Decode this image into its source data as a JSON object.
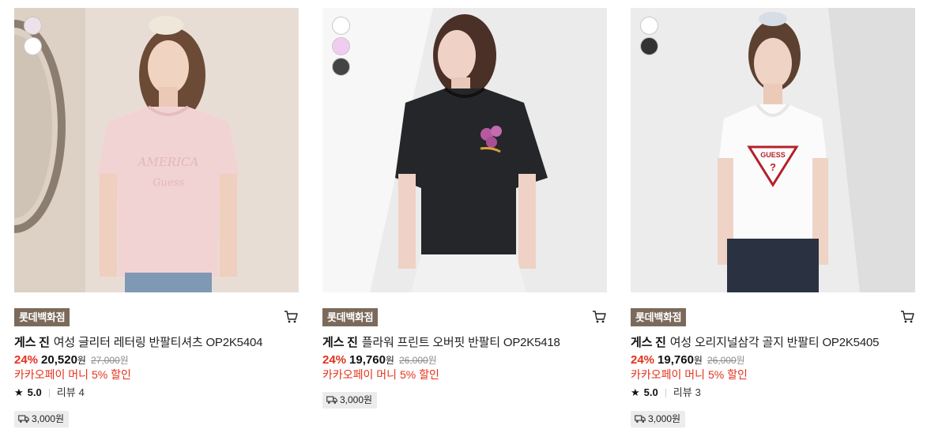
{
  "products": [
    {
      "swatches": [
        "#efe1ea",
        "#ffffff"
      ],
      "store": "롯데백화점",
      "brand": "게스 진",
      "name": "여성 글리터 레터링 반팔티셔츠 OP2K5404",
      "discount": "24%",
      "price": "20,520",
      "price_unit": "원",
      "original_price": "27,000",
      "original_unit": "원",
      "promo": "카카오페이 머니 5% 할인",
      "rating": "5.0",
      "review_label": "리뷰",
      "review_count": "4",
      "shipping": "3,000원",
      "colors": {
        "bg": "#e6dbd3",
        "shirt": "#f2d3d4"
      }
    },
    {
      "swatches": [
        "#ffffff",
        "#f0cdf0",
        "#444444"
      ],
      "store": "롯데백화점",
      "brand": "게스 진",
      "name": "플라워 프린트 오버핏 반팔티 OP2K5418",
      "discount": "24%",
      "price": "19,760",
      "price_unit": "원",
      "original_price": "26,000",
      "original_unit": "원",
      "promo": "카카오페이 머니 5% 할인",
      "shipping": "3,000원",
      "colors": {
        "bg": "#ebebec",
        "shirt": "#24262a"
      }
    },
    {
      "swatches": [
        "#ffffff",
        "#333333"
      ],
      "store": "롯데백화점",
      "brand": "게스 진",
      "name": "여성 오리지널삼각 골지 반팔티 OP2K5405",
      "discount": "24%",
      "price": "19,760",
      "price_unit": "원",
      "original_price": "26,000",
      "original_unit": "원",
      "promo": "카카오페이 머니 5% 할인",
      "rating": "5.0",
      "review_label": "리뷰",
      "review_count": "3",
      "shipping": "3,000원",
      "logo_text": "GUESS",
      "colors": {
        "bg": "#ececec",
        "shirt": "#fbfbfb"
      }
    }
  ],
  "icons": {
    "cart": "cart-icon",
    "star": "star-icon",
    "truck": "truck-icon"
  }
}
